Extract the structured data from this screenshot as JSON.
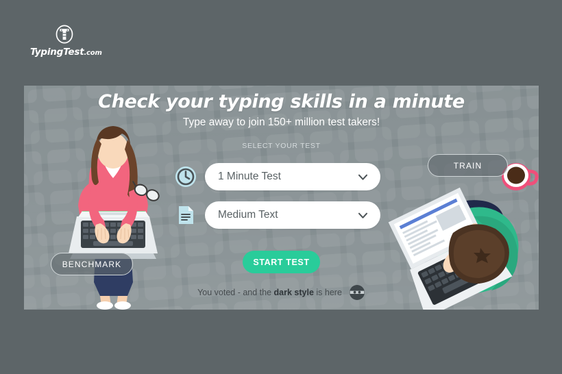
{
  "brand": {
    "name": "TypingTest",
    "tld": ".com",
    "logo_icon": "circle-t-logo-icon"
  },
  "hero": {
    "title": "Check your typing skills in a minute",
    "subtitle": "Type away to join 150+ million test takers!",
    "select_label": "SELECT YOUR TEST"
  },
  "selectors": {
    "duration": {
      "icon": "clock-icon",
      "value": "1 Minute Test",
      "chevron": "chevron-down-icon"
    },
    "text_length": {
      "icon": "document-icon",
      "value": "Medium Text",
      "chevron": "chevron-down-icon"
    }
  },
  "actions": {
    "start": "START TEST",
    "benchmark": "BENCHMARK",
    "train": "TRAIN"
  },
  "vote_note": {
    "prefix": "You voted - and the ",
    "emphasis": "dark style",
    "suffix": " is here",
    "icon": "ninja-face-icon"
  },
  "colors": {
    "page_background": "#5d6568",
    "panel_background": "#808a8d",
    "accent_green": "#29cc9a",
    "dropdown_background": "#ffffff",
    "dropdown_text": "#5a6265",
    "icon_tint": "#bfe3ec",
    "heading_text": "#ffffff"
  }
}
